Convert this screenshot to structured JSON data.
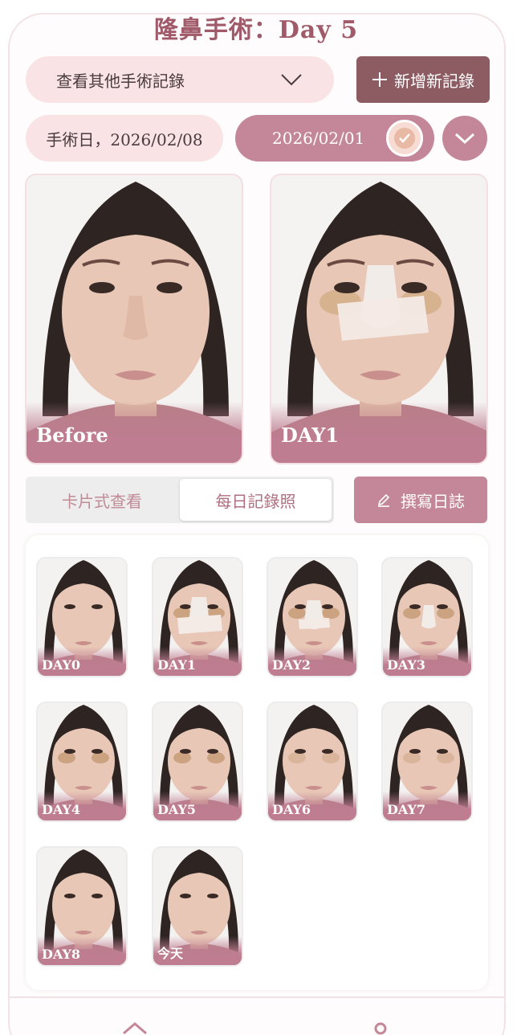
{
  "header": {
    "title": "隆鼻手術：Day 5"
  },
  "toolbar": {
    "dropdown_label": "查看其他手術記錄",
    "add_label": "新增新記錄",
    "surgery_date_label": "手術日，2026/02/08",
    "selected_date": "2026/02/01"
  },
  "comparison": {
    "left_label": "Before",
    "right_label": "DAY1"
  },
  "view_toggle": {
    "card_view": "卡片式查看",
    "daily_view": "每日記錄照",
    "active": "daily_view"
  },
  "journal": {
    "label": "撰寫日誌"
  },
  "thumbnails": [
    {
      "label": "DAY0",
      "bandage": "none",
      "bruise": 0
    },
    {
      "label": "DAY1",
      "bandage": "large",
      "bruise": 2
    },
    {
      "label": "DAY2",
      "bandage": "medium",
      "bruise": 2
    },
    {
      "label": "DAY3",
      "bandage": "small",
      "bruise": 2
    },
    {
      "label": "DAY4",
      "bandage": "none",
      "bruise": 2
    },
    {
      "label": "DAY5",
      "bandage": "none",
      "bruise": 2
    },
    {
      "label": "DAY6",
      "bandage": "none",
      "bruise": 1
    },
    {
      "label": "DAY7",
      "bandage": "none",
      "bruise": 1
    },
    {
      "label": "DAY8",
      "bandage": "none",
      "bruise": 0
    },
    {
      "label": "今天",
      "bandage": "none",
      "bruise": 0
    }
  ],
  "colors": {
    "accent": "#c4879a",
    "dark_accent": "#8d5b62",
    "title": "#a05a69",
    "pill_bg": "#f9e3e5"
  },
  "icons": {
    "dropdown": "chevron-down-icon",
    "add": "plus-icon",
    "confirm": "check-circle-icon",
    "expand": "chevron-down-icon",
    "journal": "pencil-icon",
    "nav_home": "home-icon",
    "nav_profile": "user-icon"
  }
}
